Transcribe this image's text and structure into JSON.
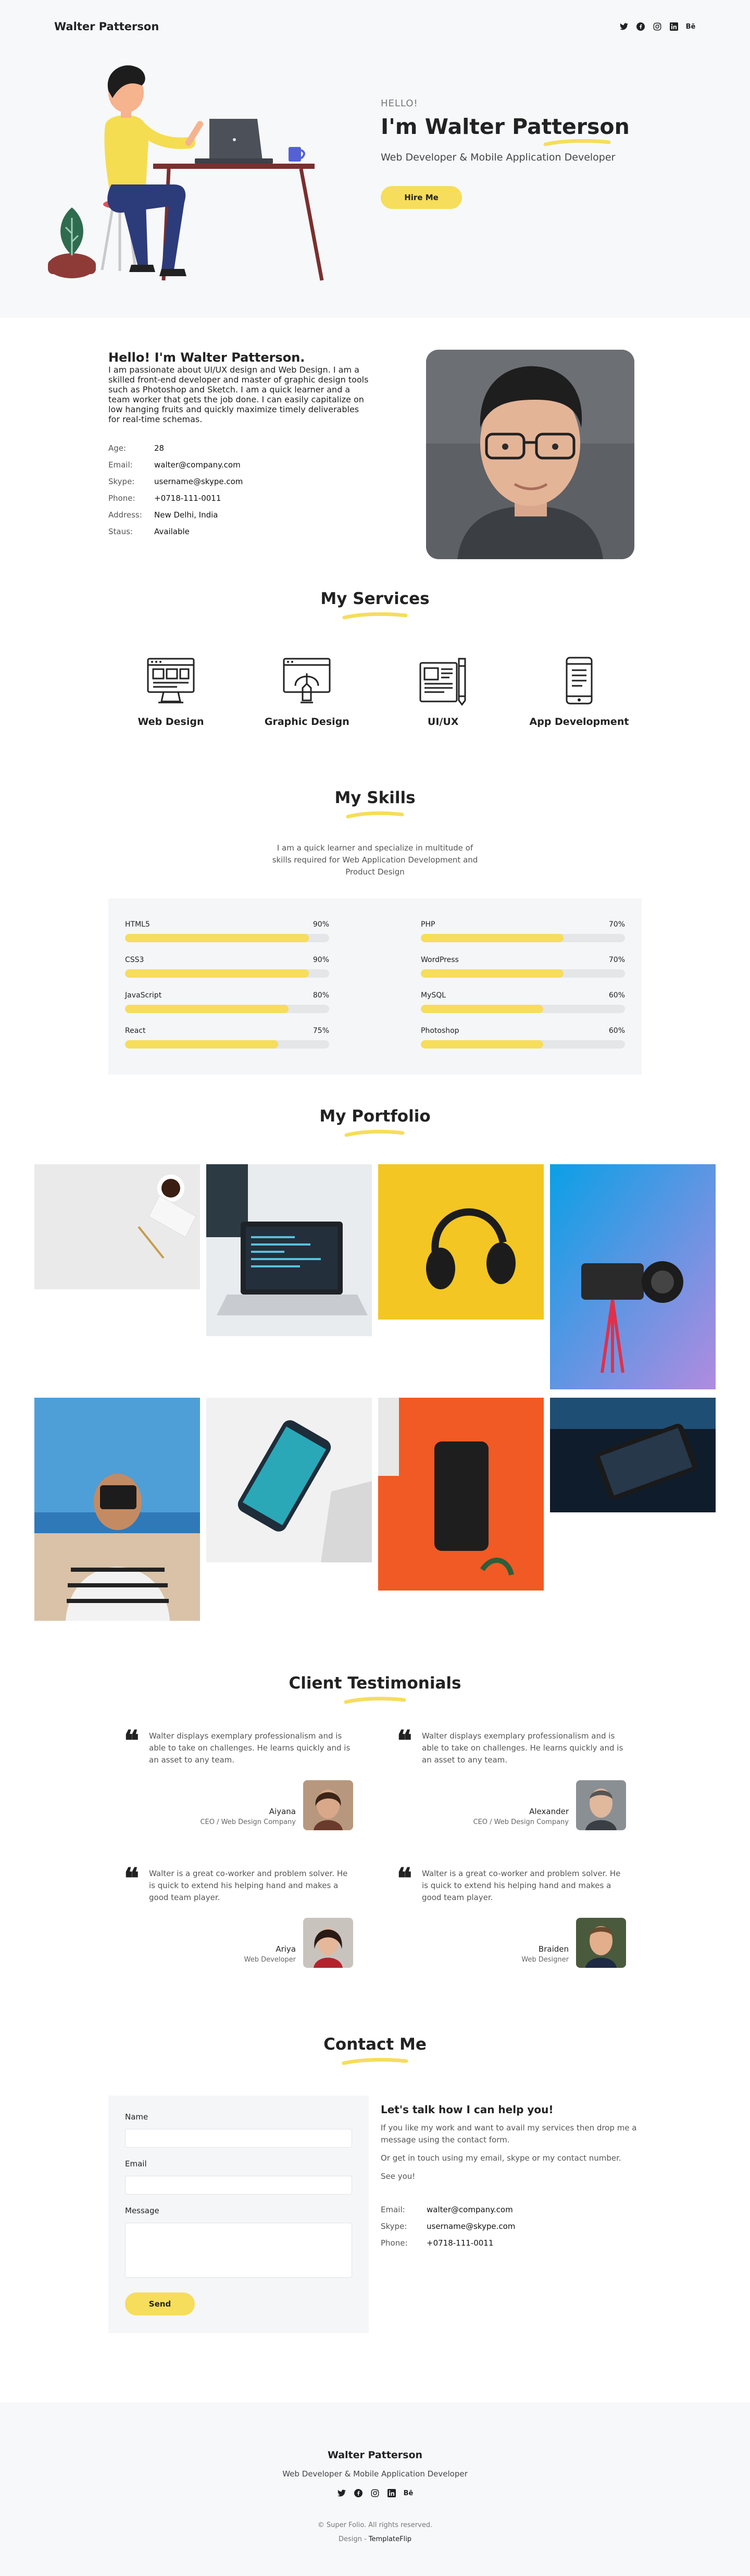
{
  "header": {
    "brand": "Walter Patterson",
    "social_icons": [
      "twitter-icon",
      "facebook-icon",
      "instagram-icon",
      "linkedin-icon",
      "behance-icon"
    ],
    "behance_text": "Bē"
  },
  "hero": {
    "greeting": "HELLO!",
    "name": "I'm Walter Patterson",
    "role": "Web Developer & Mobile Application Developer",
    "cta": "Hire Me"
  },
  "about": {
    "heading": "Hello! I'm Walter Patterson.",
    "bio": "I am passionate about UI/UX design and Web Design. I am a skilled front-end developer and master of graphic design tools such as Photoshop and Sketch. I am a quick learner and a team worker that gets the job done. I can easily capitalize on low hanging fruits and quickly maximize timely deliverables for real-time schemas.",
    "info": [
      {
        "label": "Age:",
        "value": "28"
      },
      {
        "label": "Email:",
        "value": "walter@company.com"
      },
      {
        "label": "Skype:",
        "value": "username@skype.com"
      },
      {
        "label": "Phone:",
        "value": "+0718-111-0011"
      },
      {
        "label": "Address:",
        "value": "New Delhi, India"
      },
      {
        "label": "Staus:",
        "value": "Available"
      }
    ]
  },
  "services": {
    "title": "My Services",
    "items": [
      {
        "label": "Web Design",
        "icon": "web-design-icon"
      },
      {
        "label": "Graphic Design",
        "icon": "graphic-design-icon"
      },
      {
        "label": "UI/UX",
        "icon": "ui-ux-icon"
      },
      {
        "label": "App Development",
        "icon": "app-development-icon"
      }
    ]
  },
  "skills": {
    "title": "My Skills",
    "intro": "I am a quick learner and specialize in multitude of skills required for Web Application Development and Product Design",
    "left": [
      {
        "name": "HTML5",
        "percent": "90%",
        "level": 90
      },
      {
        "name": "CSS3",
        "percent": "90%",
        "level": 90
      },
      {
        "name": "JavaScript",
        "percent": "80%",
        "level": 80
      },
      {
        "name": "React",
        "percent": "75%",
        "level": 75
      }
    ],
    "right": [
      {
        "name": "PHP",
        "percent": "70%",
        "level": 70
      },
      {
        "name": "WordPress",
        "percent": "70%",
        "level": 70
      },
      {
        "name": "MySQL",
        "percent": "60%",
        "level": 60
      },
      {
        "name": "Photoshop",
        "percent": "60%",
        "level": 60
      }
    ]
  },
  "portfolio": {
    "title": "My Portfolio"
  },
  "testimonials": {
    "title": "Client Testimonials",
    "items": [
      {
        "text": "Walter displays exemplary professionalism and is able to take on challenges. He learns quickly and is an asset to any team.",
        "name": "Aiyana",
        "role": "CEO / Web Design Company"
      },
      {
        "text": "Walter displays exemplary professionalism and is able to take on challenges. He learns quickly and is an asset to any team.",
        "name": "Alexander",
        "role": "CEO / Web Design Company"
      },
      {
        "text": "Walter is a great co-worker and problem solver. He is quick to extend his helping hand and makes a good team player.",
        "name": "Ariya",
        "role": "Web Developer"
      },
      {
        "text": "Walter is a great co-worker and problem solver. He is quick to extend his helping hand and makes a good team player.",
        "name": "Braiden",
        "role": "Web Designer"
      }
    ]
  },
  "contact": {
    "title": "Contact Me",
    "form": {
      "name_label": "Name",
      "email_label": "Email",
      "message_label": "Message",
      "send": "Send"
    },
    "heading": "Let's talk how I can help you!",
    "p1": "If you like my work and want to avail my services then drop me a message using the contact form.",
    "p2": "Or get in touch using my email, skype or my contact number.",
    "p3": "See you!",
    "info": [
      {
        "label": "Email:",
        "value": "walter@company.com"
      },
      {
        "label": "Skype:",
        "value": "username@skype.com"
      },
      {
        "label": "Phone:",
        "value": "+0718-111-0011"
      }
    ]
  },
  "footer": {
    "name": "Walter Patterson",
    "role": "Web Developer & Mobile Application Developer",
    "copyright": "© Super Folio. All rights reserved.",
    "design_prefix": "Design - ",
    "design_link": "TemplateFlip"
  },
  "colors": {
    "accent": "#f6dd5b",
    "light_bg": "#f7f8fa",
    "text": "#222222"
  }
}
